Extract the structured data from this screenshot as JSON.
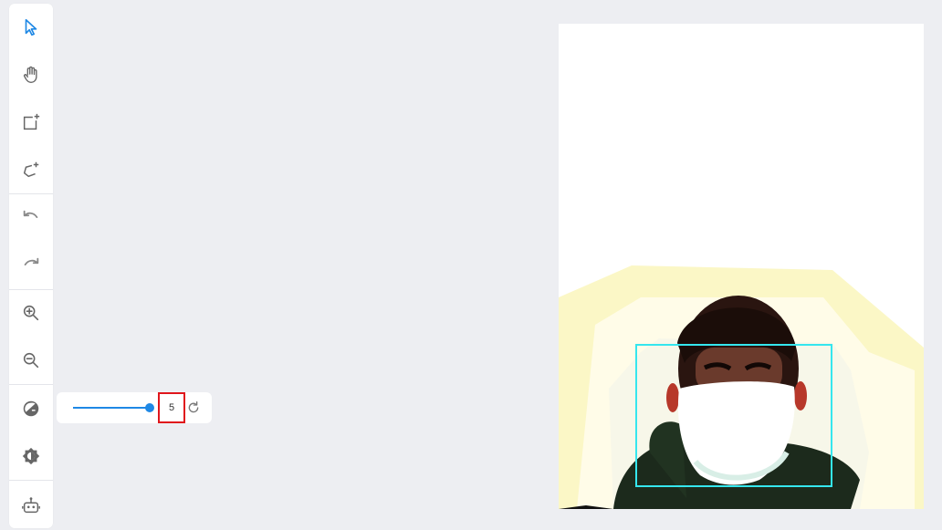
{
  "toolbar": {
    "tools": [
      {
        "id": "select",
        "icon": "cursor-icon",
        "active": true
      },
      {
        "id": "pan",
        "icon": "hand-icon"
      },
      {
        "id": "add-rectangle",
        "icon": "add-rectangle-icon"
      },
      {
        "id": "add-polygon",
        "icon": "add-polygon-icon"
      },
      {
        "id": "undo",
        "icon": "undo-icon"
      },
      {
        "id": "redo",
        "icon": "redo-icon"
      },
      {
        "id": "zoom-in",
        "icon": "zoom-in-icon"
      },
      {
        "id": "zoom-out",
        "icon": "zoom-out-icon"
      },
      {
        "id": "brightness",
        "icon": "brightness-icon"
      },
      {
        "id": "contrast",
        "icon": "contrast-icon"
      },
      {
        "id": "auto-annotate",
        "icon": "robot-icon"
      }
    ],
    "active_color": "#1e88e5",
    "icon_color": "#666666"
  },
  "brightness_panel": {
    "value": "5",
    "slider_level": 1.0,
    "reset_icon": "refresh-icon"
  },
  "canvas": {
    "bbox_color": "#35e6ee"
  }
}
